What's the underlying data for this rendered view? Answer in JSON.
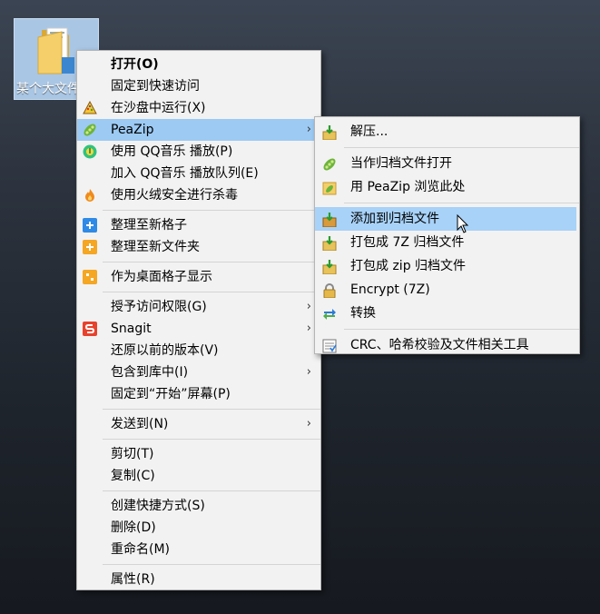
{
  "desktop_icon": {
    "label": "某个大文件夹"
  },
  "context_menu": {
    "items": [
      {
        "label": "打开(O)"
      },
      {
        "label": "固定到快速访问"
      },
      {
        "label": "在沙盘中运行(X)"
      },
      {
        "label": "PeaZip"
      },
      {
        "label": "使用 QQ音乐 播放(P)"
      },
      {
        "label": "加入 QQ音乐 播放队列(E)"
      },
      {
        "label": "使用火绒安全进行杀毒"
      },
      {
        "label": "整理至新格子"
      },
      {
        "label": "整理至新文件夹"
      },
      {
        "label": "作为桌面格子显示"
      },
      {
        "label": "授予访问权限(G)"
      },
      {
        "label": "Snagit"
      },
      {
        "label": "还原以前的版本(V)"
      },
      {
        "label": "包含到库中(I)"
      },
      {
        "label": "固定到“开始”屏幕(P)"
      },
      {
        "label": "发送到(N)"
      },
      {
        "label": "剪切(T)"
      },
      {
        "label": "复制(C)"
      },
      {
        "label": "创建快捷方式(S)"
      },
      {
        "label": "删除(D)"
      },
      {
        "label": "重命名(M)"
      },
      {
        "label": "属性(R)"
      }
    ]
  },
  "peazip_submenu": {
    "items": [
      {
        "label": "解压..."
      },
      {
        "label": "当作归档文件打开"
      },
      {
        "label": "用 PeaZip 浏览此处"
      },
      {
        "label": "添加到归档文件"
      },
      {
        "label": "打包成 7Z 归档文件"
      },
      {
        "label": "打包成 zip 归档文件"
      },
      {
        "label": "Encrypt (7Z)"
      },
      {
        "label": "转换"
      },
      {
        "label": "CRC、哈希校验及文件相关工具"
      }
    ]
  },
  "icons": {
    "desktop": "folder-icon",
    "main": [
      "sandbox-icon",
      "peazip-icon",
      "qq-music-icon",
      "huorong-icon",
      "plus-icon",
      "folder-plus-icon",
      "desktop-grid-icon",
      "snagit-icon"
    ],
    "sub": [
      "extract-icon",
      "peazip-icon",
      "peazip-browse-icon",
      "add-archive-icon",
      "pack-7z-icon",
      "pack-zip-icon",
      "lock-icon",
      "convert-icon",
      "checklist-icon"
    ]
  },
  "colors": {
    "highlight": "#9ccaf3",
    "menu_background": "#f2f2f2",
    "desktop_selection": "#a9c6e4"
  }
}
